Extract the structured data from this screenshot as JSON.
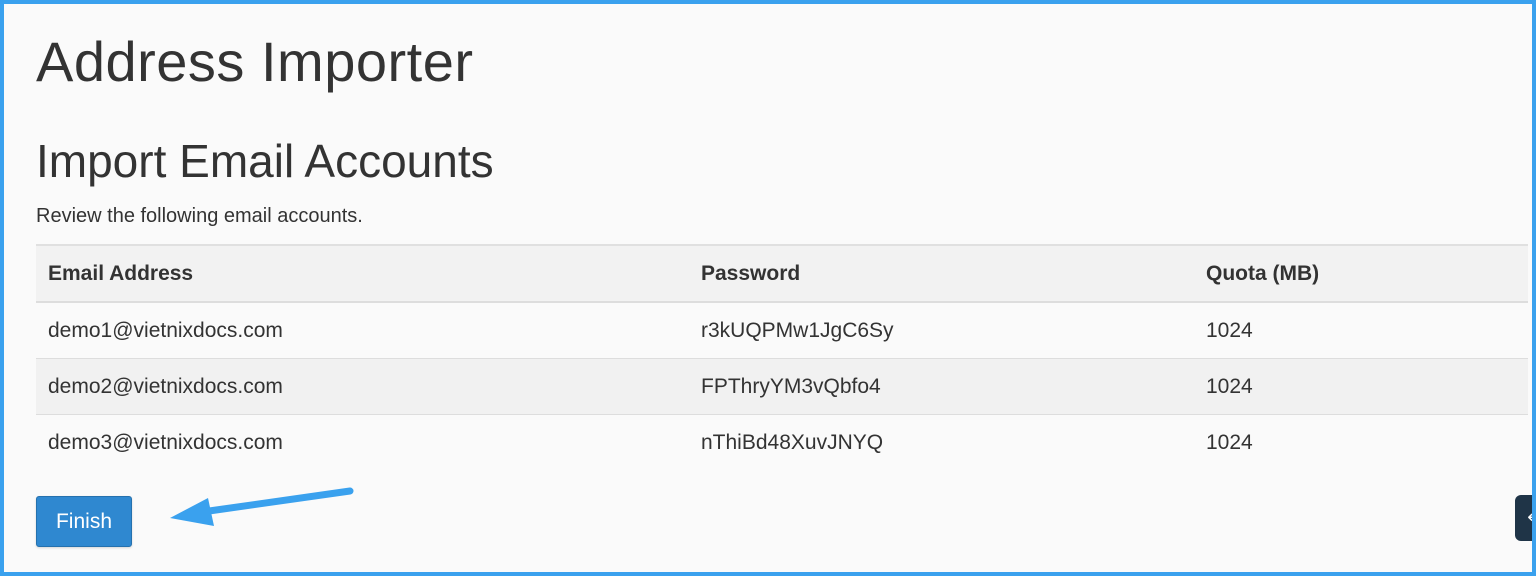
{
  "page": {
    "title": "Address Importer",
    "section_title": "Import Email Accounts",
    "description": "Review the following email accounts."
  },
  "table": {
    "headers": {
      "email": "Email Address",
      "password": "Password",
      "quota": "Quota (MB)"
    },
    "rows": [
      {
        "email": "demo1@vietnixdocs.com",
        "password": "r3kUQPMw1JgC6Sy",
        "quota": "1024"
      },
      {
        "email": "demo2@vietnixdocs.com",
        "password": "FPThryYM3vQbfo4",
        "quota": "1024"
      },
      {
        "email": "demo3@vietnixdocs.com",
        "password": "nThiBd48XuvJNYQ",
        "quota": "1024"
      }
    ]
  },
  "actions": {
    "finish_label": "Finish"
  },
  "annotation": {
    "arrow_icon": "arrow-left-icon",
    "arrow_color": "#3aa1ee"
  },
  "colors": {
    "frame_border": "#3aa1ee",
    "primary_button": "#2f88d0",
    "corner_widget": "#1f3447"
  }
}
